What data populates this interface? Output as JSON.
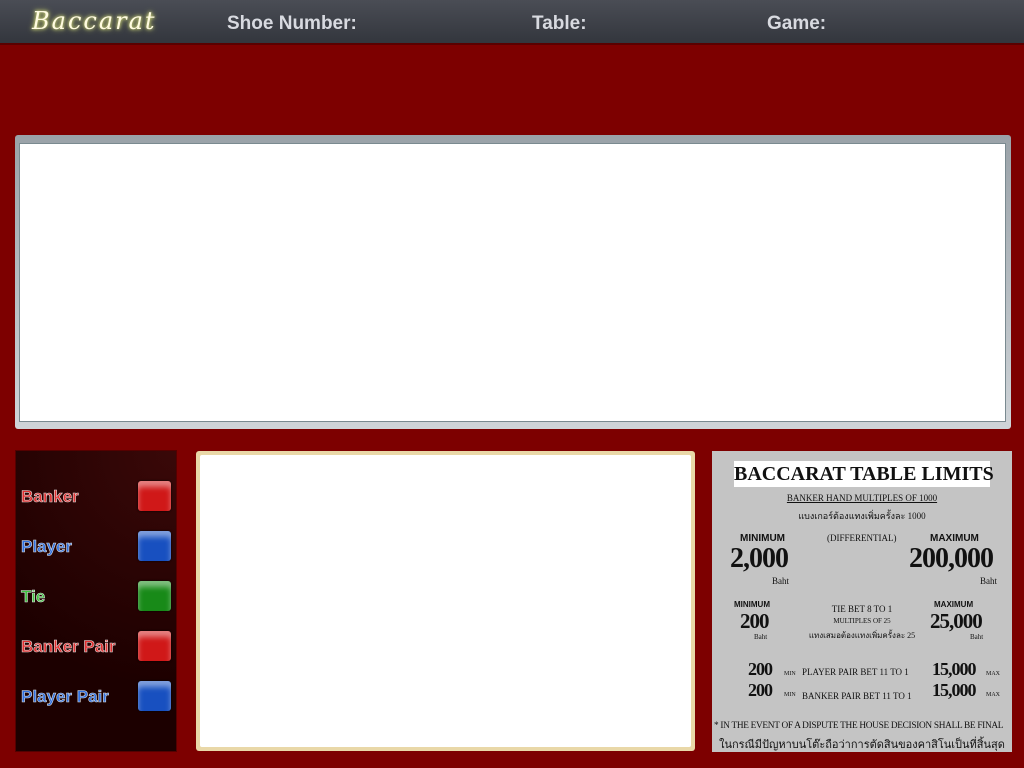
{
  "header": {
    "logo": "Baccarat",
    "shoe_label": "Shoe Number:",
    "table_label": "Table:",
    "game_label": "Game:"
  },
  "legend": [
    {
      "label": "Banker",
      "color": "#e02020"
    },
    {
      "label": "Player",
      "color": "#2060d8"
    },
    {
      "label": "Tie",
      "color": "#20a020"
    },
    {
      "label": "Banker Pair",
      "color": "#e02020"
    },
    {
      "label": "Player Pair",
      "color": "#2060d8"
    }
  ],
  "limits": {
    "title": "BACCARAT TABLE LIMITS",
    "banker_multiples": "BANKER HAND MULTIPLES OF 1000",
    "banker_multiples_th": "แบงเกอร์ต้องแทงเพิ่มครั้งละ 1000",
    "minimum": "MINIMUM",
    "maximum": "MAXIMUM",
    "differential": "(DIFFERENTIAL)",
    "main_min": "2,000",
    "main_max": "200,000",
    "baht": "Baht",
    "tie_min": "200",
    "tie_max": "25,000",
    "tie_bet": "TIE BET 8 TO 1",
    "tie_multiples": "MULTIPLES OF 25",
    "tie_multiples_th": "แทงเสมอต้องแทงเพิ่มครั้งละ 25",
    "pp_min": "200",
    "pp_max": "15,000",
    "bp_min": "200",
    "bp_max": "15,000",
    "min_suffix": "MIN",
    "max_suffix": "MAX",
    "player_pair": "PLAYER PAIR BET 11 TO 1",
    "banker_pair": "BANKER PAIR BET 11 TO 1",
    "disclaimer": "* IN THE EVENT OF A DISPUTE THE HOUSE DECISION SHALL BE FINAL",
    "disclaimer_th": "ในกรณีมีปัญหาบนโต๊ะถือว่าการตัดสินของคาสิโนเป็นที่สิ้นสุด"
  }
}
